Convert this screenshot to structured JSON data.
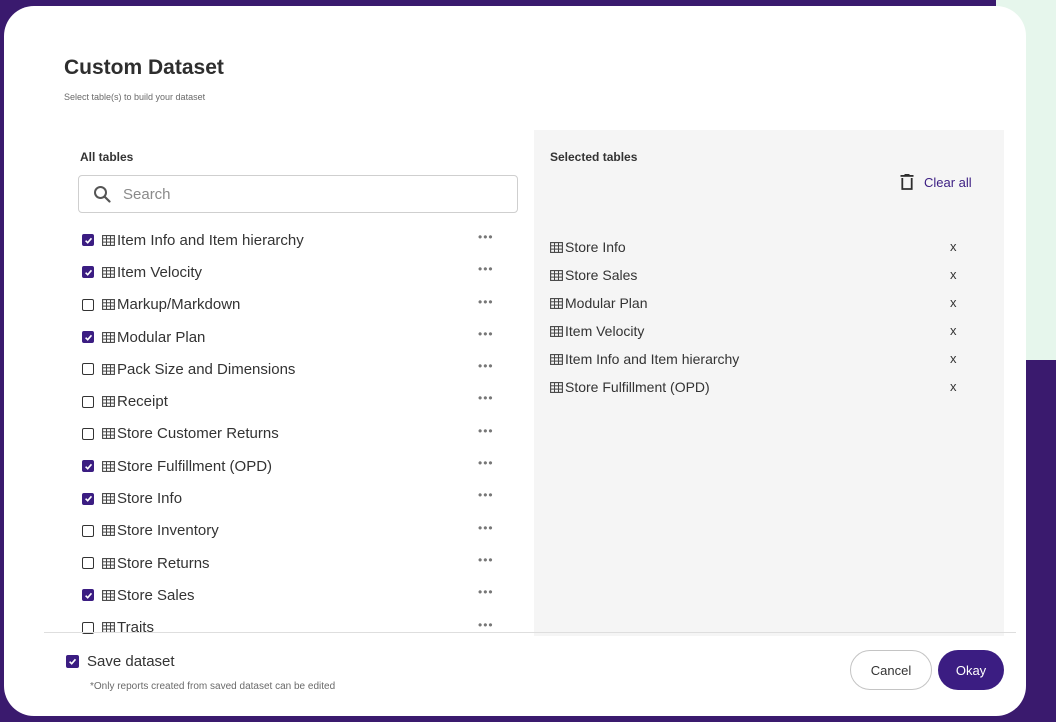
{
  "colors": {
    "accent": "#3b1d82",
    "frame": "#3a1a6e",
    "panel_bg": "#f5f5f5"
  },
  "dialog": {
    "title": "Custom Dataset",
    "subtitle": "Select table(s) to build your dataset"
  },
  "all_tables": {
    "label": "All tables",
    "search": {
      "placeholder": "Search",
      "value": "",
      "icon": "search-icon"
    },
    "items": [
      {
        "name": "Item Info and Item hierarchy",
        "checked": true
      },
      {
        "name": "Item Velocity",
        "checked": true
      },
      {
        "name": "Markup/Markdown",
        "checked": false
      },
      {
        "name": "Modular Plan",
        "checked": true
      },
      {
        "name": "Pack Size and Dimensions",
        "checked": false
      },
      {
        "name": "Receipt",
        "checked": false
      },
      {
        "name": "Store Customer Returns",
        "checked": false
      },
      {
        "name": "Store Fulfillment (OPD)",
        "checked": true
      },
      {
        "name": "Store Info",
        "checked": true
      },
      {
        "name": "Store Inventory",
        "checked": false
      },
      {
        "name": "Store Returns",
        "checked": false
      },
      {
        "name": "Store Sales",
        "checked": true
      },
      {
        "name": "Traits",
        "checked": false
      }
    ],
    "more_label": "•••"
  },
  "selected_tables": {
    "label": "Selected tables",
    "clear_all": "Clear all",
    "remove_label": "x",
    "items": [
      "Store Info",
      "Store Sales",
      "Modular Plan",
      "Item Velocity",
      "Item Info and Item hierarchy",
      "Store Fulfillment (OPD)"
    ]
  },
  "footer": {
    "save_label": "Save dataset",
    "save_checked": true,
    "note": "*Only reports created from saved dataset can be edited",
    "cancel": "Cancel",
    "okay": "Okay"
  }
}
